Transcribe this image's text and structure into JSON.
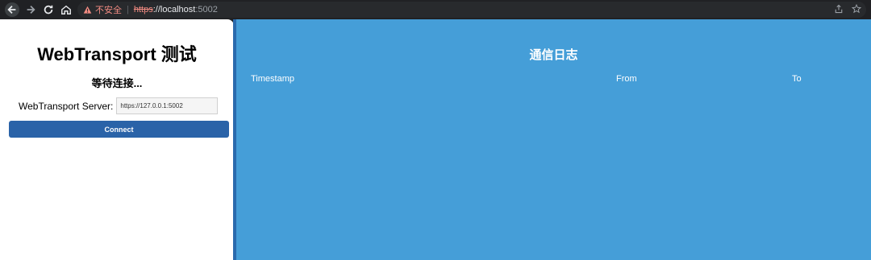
{
  "browser": {
    "security_label": "不安全",
    "url_scheme": "https",
    "url_separator": "://",
    "url_host": "localhost",
    "url_port": ":5002"
  },
  "left": {
    "title": "WebTransport 测试",
    "status": "等待连接...",
    "server_label": "WebTransport Server:",
    "server_value": "https://127.0.0.1:5002",
    "connect_label": "Connect"
  },
  "log": {
    "title": "通信日志",
    "columns": [
      "Timestamp",
      "From",
      "To"
    ]
  },
  "colors": {
    "panel_blue": "#459ed8",
    "button_blue": "#2a63a8",
    "divider_blue": "#2a6aad"
  }
}
